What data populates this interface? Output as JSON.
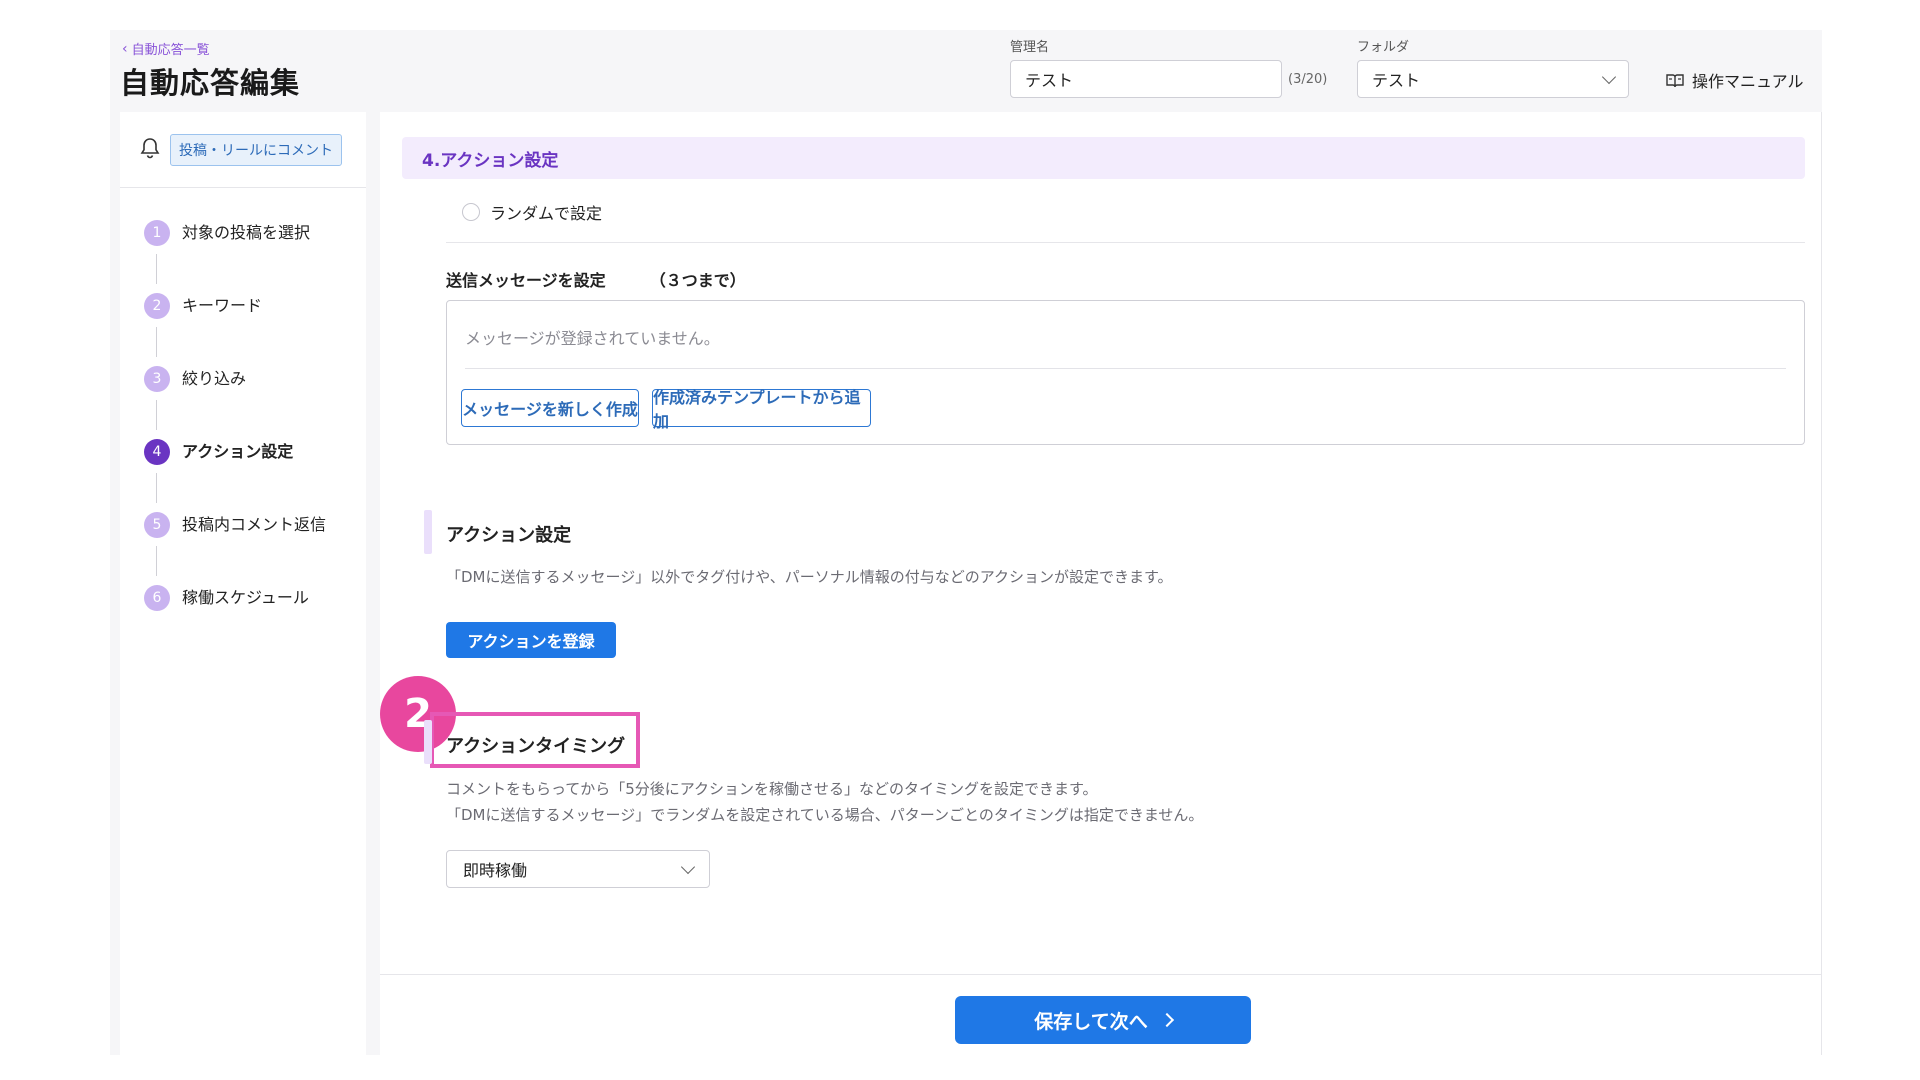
{
  "header": {
    "back_label": "自動応答一覧",
    "title": "自動応答編集",
    "name_label": "管理名",
    "name_value": "テスト",
    "name_count": "(3/20)",
    "folder_label": "フォルダ",
    "folder_value": "テスト",
    "manual_label": "操作マニュアル"
  },
  "sidebar": {
    "trigger_badge": "投稿・リールにコメント",
    "steps": [
      {
        "num": "1",
        "label": "対象の投稿を選択"
      },
      {
        "num": "2",
        "label": "キーワード"
      },
      {
        "num": "3",
        "label": "絞り込み"
      },
      {
        "num": "4",
        "label": "アクション設定"
      },
      {
        "num": "5",
        "label": "投稿内コメント返信"
      },
      {
        "num": "6",
        "label": "稼働スケジュール"
      }
    ],
    "active_step": "4"
  },
  "main": {
    "section_title": "4.アクション設定",
    "random_label": "ランダムで設定",
    "message_heading": "送信メッセージを設定",
    "message_limit": "（３つまで）",
    "message_empty": "メッセージが登録されていません。",
    "new_message_button": "メッセージを新しく作成",
    "template_button": "作成済みテンプレートから追加",
    "action_heading": "アクション設定",
    "action_desc": "「DMに送信するメッセージ」以外でタグ付けや、パーソナル情報の付与などのアクションが設定できます。",
    "action_button": "アクションを登録",
    "callout_number": "2",
    "timing_heading": "アクションタイミング",
    "timing_desc_1": "コメントをもらってから「5分後にアクションを稼働させる」などのタイミングを設定できます。",
    "timing_desc_2": "「DMに送信するメッセージ」でランダムを設定されている場合、パターンごとのタイミングは指定できません。",
    "timing_value": "即時稼働",
    "save_button": "保存して次へ"
  },
  "colors": {
    "accent_purple": "#6a34c2",
    "primary_blue": "#1f78e6",
    "highlight_pink": "#e658b5"
  }
}
